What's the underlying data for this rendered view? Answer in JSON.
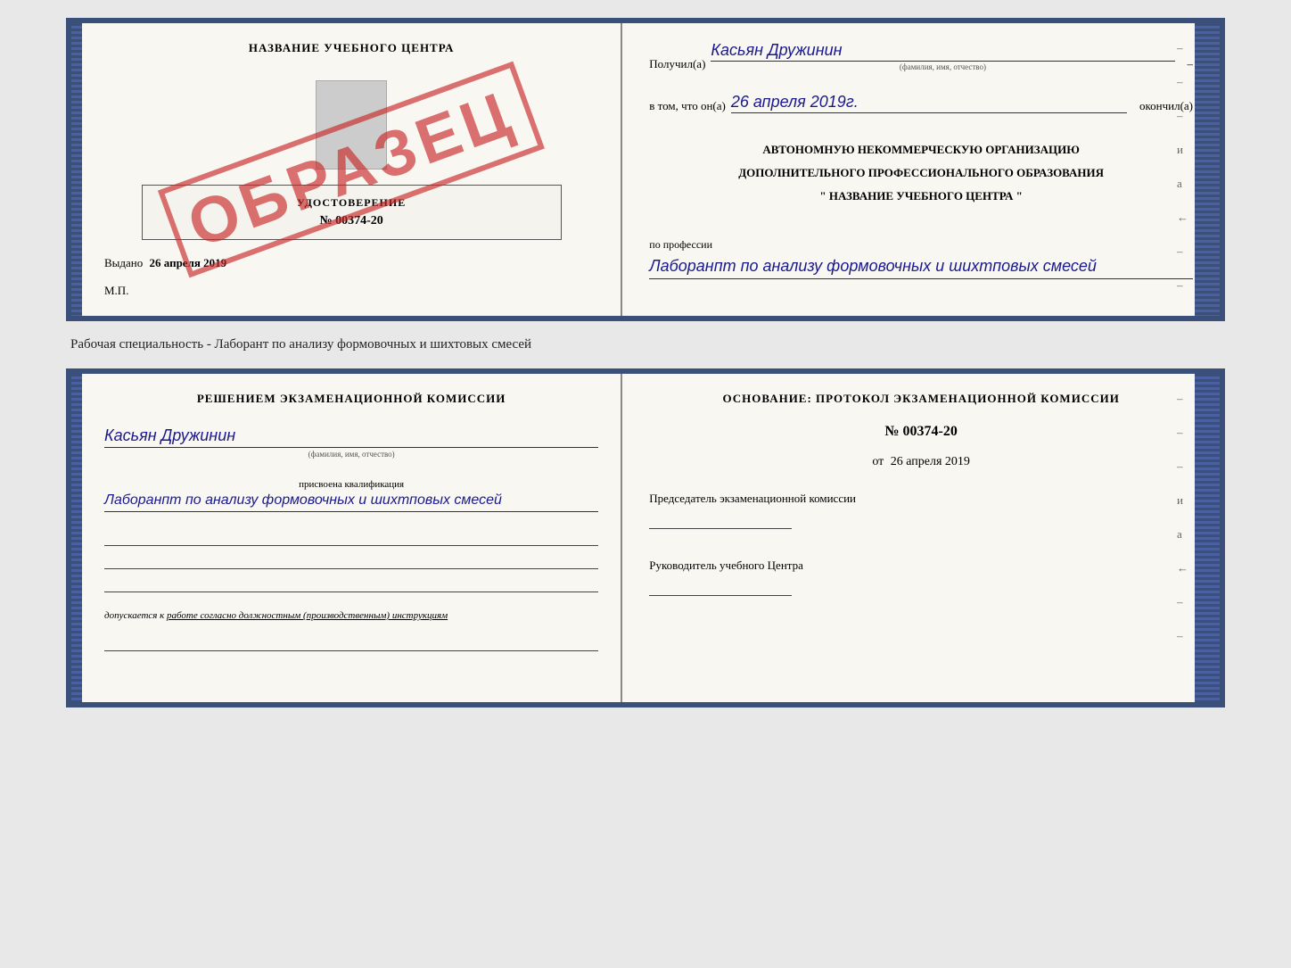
{
  "page": {
    "background": "#e8e8e8"
  },
  "top_cert": {
    "left": {
      "title": "НАЗВАНИЕ УЧЕБНОГО ЦЕНТРА",
      "inner_title": "УДОСТОВЕРЕНИЕ",
      "inner_number": "№ 00374-20",
      "issued_label": "Выдано",
      "issued_date": "26 апреля 2019",
      "mp_label": "М.П."
    },
    "stamp": "ОБРАЗЕЦ",
    "right": {
      "received_label": "Получил(а)",
      "received_name": "Касьян Дружинин",
      "received_sub": "(фамилия, имя, отчество)",
      "date_label": "в том, что он(а)",
      "date_value": "26 апреля 2019г.",
      "finished_label": "окончил(а)",
      "org_line1": "АВТОНОМНУЮ НЕКОММЕРЧЕСКУЮ ОРГАНИЗАЦИЮ",
      "org_line2": "ДОПОЛНИТЕЛЬНОГО ПРОФЕССИОНАЛЬНОГО ОБРАЗОВАНИЯ",
      "org_line3": "\"  НАЗВАНИЕ УЧЕБНОГО ЦЕНТРА  \"",
      "profession_label": "по профессии",
      "profession_value": "Лаборанпт по анализу формовочных и шихтповых смесей"
    }
  },
  "specialty_text": "Рабочая специальность - Лаборант по анализу формовочных и шихтовых смесей",
  "bottom_cert": {
    "left": {
      "decision_title": "Решением экзаменационной комиссии",
      "name_value": "Касьян Дружинин",
      "name_sub": "(фамилия, имя, отчество)",
      "qualification_label": "присвоена квалификация",
      "qualification_value": "Лаборанпт по анализу формовочных и шихтповых смесей",
      "допуск_label": "допускается к",
      "допуск_value": "работе согласно должностным (производственным) инструкциям"
    },
    "right": {
      "osnov_label": "Основание: протокол экзаменационной комиссии",
      "protocol_number": "№ 00374-20",
      "date_prefix": "от",
      "date_value": "26 апреля 2019",
      "chairman_label": "Председатель экзаменационной комиссии",
      "head_label": "Руководитель учебного Центра"
    }
  },
  "dashes": [
    "-",
    "-",
    "-",
    "и",
    "а",
    "←",
    "-",
    "-",
    "-"
  ]
}
